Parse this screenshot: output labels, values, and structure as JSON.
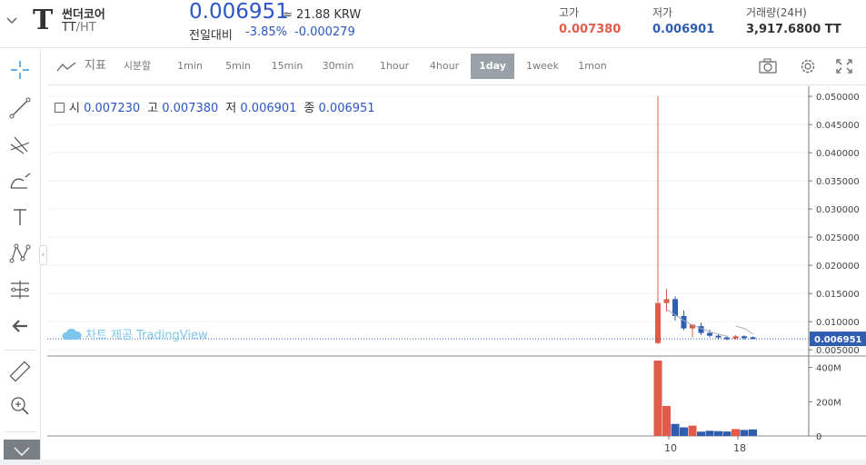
{
  "header": {
    "logo_letter": "T",
    "coin_name": "썬더코어",
    "pair_base": "TT",
    "pair_quote": "/HT",
    "price": "0.006951",
    "krw_equiv": "≈ 21.88 KRW",
    "change_label": "전일대비",
    "change_pct": "-3.85%",
    "change_abs": "-0.000279",
    "high_label": "고가",
    "high_value": "0.007380",
    "low_label": "저가",
    "low_value": "0.006901",
    "volume_label": "거래량(24H)",
    "volume_value": "3,917.6800 TT"
  },
  "toolbar": {
    "indicator_label": "지표",
    "timeframes": [
      "시분할",
      "1min",
      "5min",
      "15min",
      "30min",
      "1hour",
      "4hour",
      "1day",
      "1week",
      "1mon"
    ],
    "active_timeframe": "1day"
  },
  "sidebar": {
    "tools": [
      "crosshair-icon",
      "trendline-icon",
      "fib-icon",
      "brush-icon",
      "text-icon",
      "pattern-icon",
      "measure-icon",
      "back-arrow-icon",
      "ruler-icon",
      "zoom-in-icon",
      "bottom-icon"
    ]
  },
  "legend": {
    "open_label": "시",
    "open_value": "0.007230",
    "high_label": "고",
    "high_value": "0.007380",
    "low_label": "저",
    "low_value": "0.006901",
    "close_label": "종",
    "close_value": "0.006951"
  },
  "watermark": "차트 제공 TradingView",
  "colors": {
    "up": "#e05c4a",
    "down": "#2f5db0",
    "accent": "#2a56c6",
    "grid": "#eef0f3"
  },
  "chart_data": {
    "type": "candlestick",
    "price_axis_ticks": [
      "0.005000",
      "0.010000",
      "0.015000",
      "0.020000",
      "0.025000",
      "0.030000",
      "0.035000",
      "0.040000",
      "0.045000",
      "0.050000"
    ],
    "last_price_label": "0.006951",
    "volume_axis_ticks": [
      "0",
      "200M",
      "400M"
    ],
    "x_tick_labels": [
      "10",
      "18"
    ],
    "candles": [
      {
        "open": 0.0062,
        "high": 0.05,
        "low": 0.006,
        "close": 0.0133,
        "volume": 440
      },
      {
        "open": 0.0133,
        "high": 0.0158,
        "low": 0.0118,
        "close": 0.014,
        "volume": 175
      },
      {
        "open": 0.014,
        "high": 0.0145,
        "low": 0.0102,
        "close": 0.011,
        "volume": 70
      },
      {
        "open": 0.011,
        "high": 0.012,
        "low": 0.0085,
        "close": 0.0088,
        "volume": 50
      },
      {
        "open": 0.0088,
        "high": 0.0094,
        "low": 0.0072,
        "close": 0.0095,
        "volume": 60
      },
      {
        "open": 0.0092,
        "high": 0.0098,
        "low": 0.0076,
        "close": 0.008,
        "volume": 25
      },
      {
        "open": 0.008,
        "high": 0.0086,
        "low": 0.0072,
        "close": 0.0075,
        "volume": 30
      },
      {
        "open": 0.0075,
        "high": 0.0078,
        "low": 0.0068,
        "close": 0.0072,
        "volume": 28
      },
      {
        "open": 0.0072,
        "high": 0.0075,
        "low": 0.0067,
        "close": 0.007,
        "volume": 26
      },
      {
        "open": 0.007,
        "high": 0.0076,
        "low": 0.0068,
        "close": 0.0074,
        "volume": 40
      },
      {
        "open": 0.0074,
        "high": 0.0076,
        "low": 0.0068,
        "close": 0.0071,
        "volume": 35
      },
      {
        "open": 0.00723,
        "high": 0.00738,
        "low": 0.006901,
        "close": 0.006951,
        "volume": 38
      }
    ],
    "ma": [
      0.0128,
      0.0122,
      0.0112,
      0.0102,
      0.0094,
      0.0088,
      0.0082,
      0.0078,
      0.0074,
      0.0092,
      0.0088,
      0.0078
    ]
  }
}
